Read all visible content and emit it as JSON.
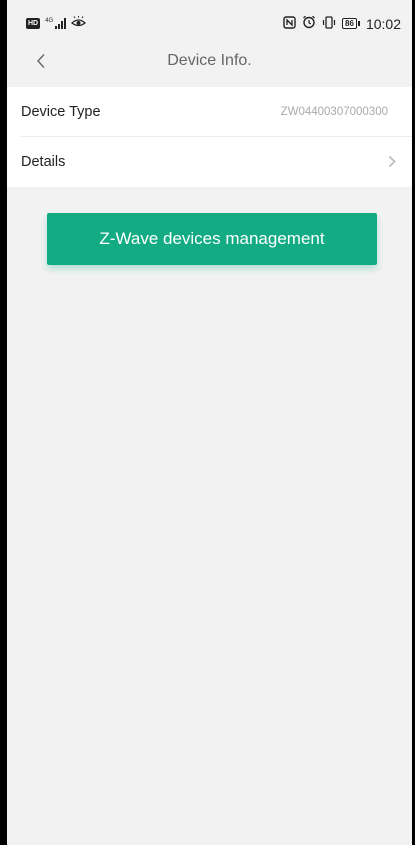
{
  "status_bar": {
    "hd_label": "HD",
    "network_label": "4G",
    "battery_level": "86",
    "time": "10:02"
  },
  "header": {
    "title": "Device Info."
  },
  "rows": {
    "device_type_label": "Device Type",
    "device_type_value": "ZW04400307000300",
    "details_label": "Details"
  },
  "actions": {
    "zwave_button_label": "Z-Wave devices management"
  },
  "colors": {
    "accent": "#12ab84",
    "background": "#f2f2f2",
    "card": "#ffffff"
  }
}
